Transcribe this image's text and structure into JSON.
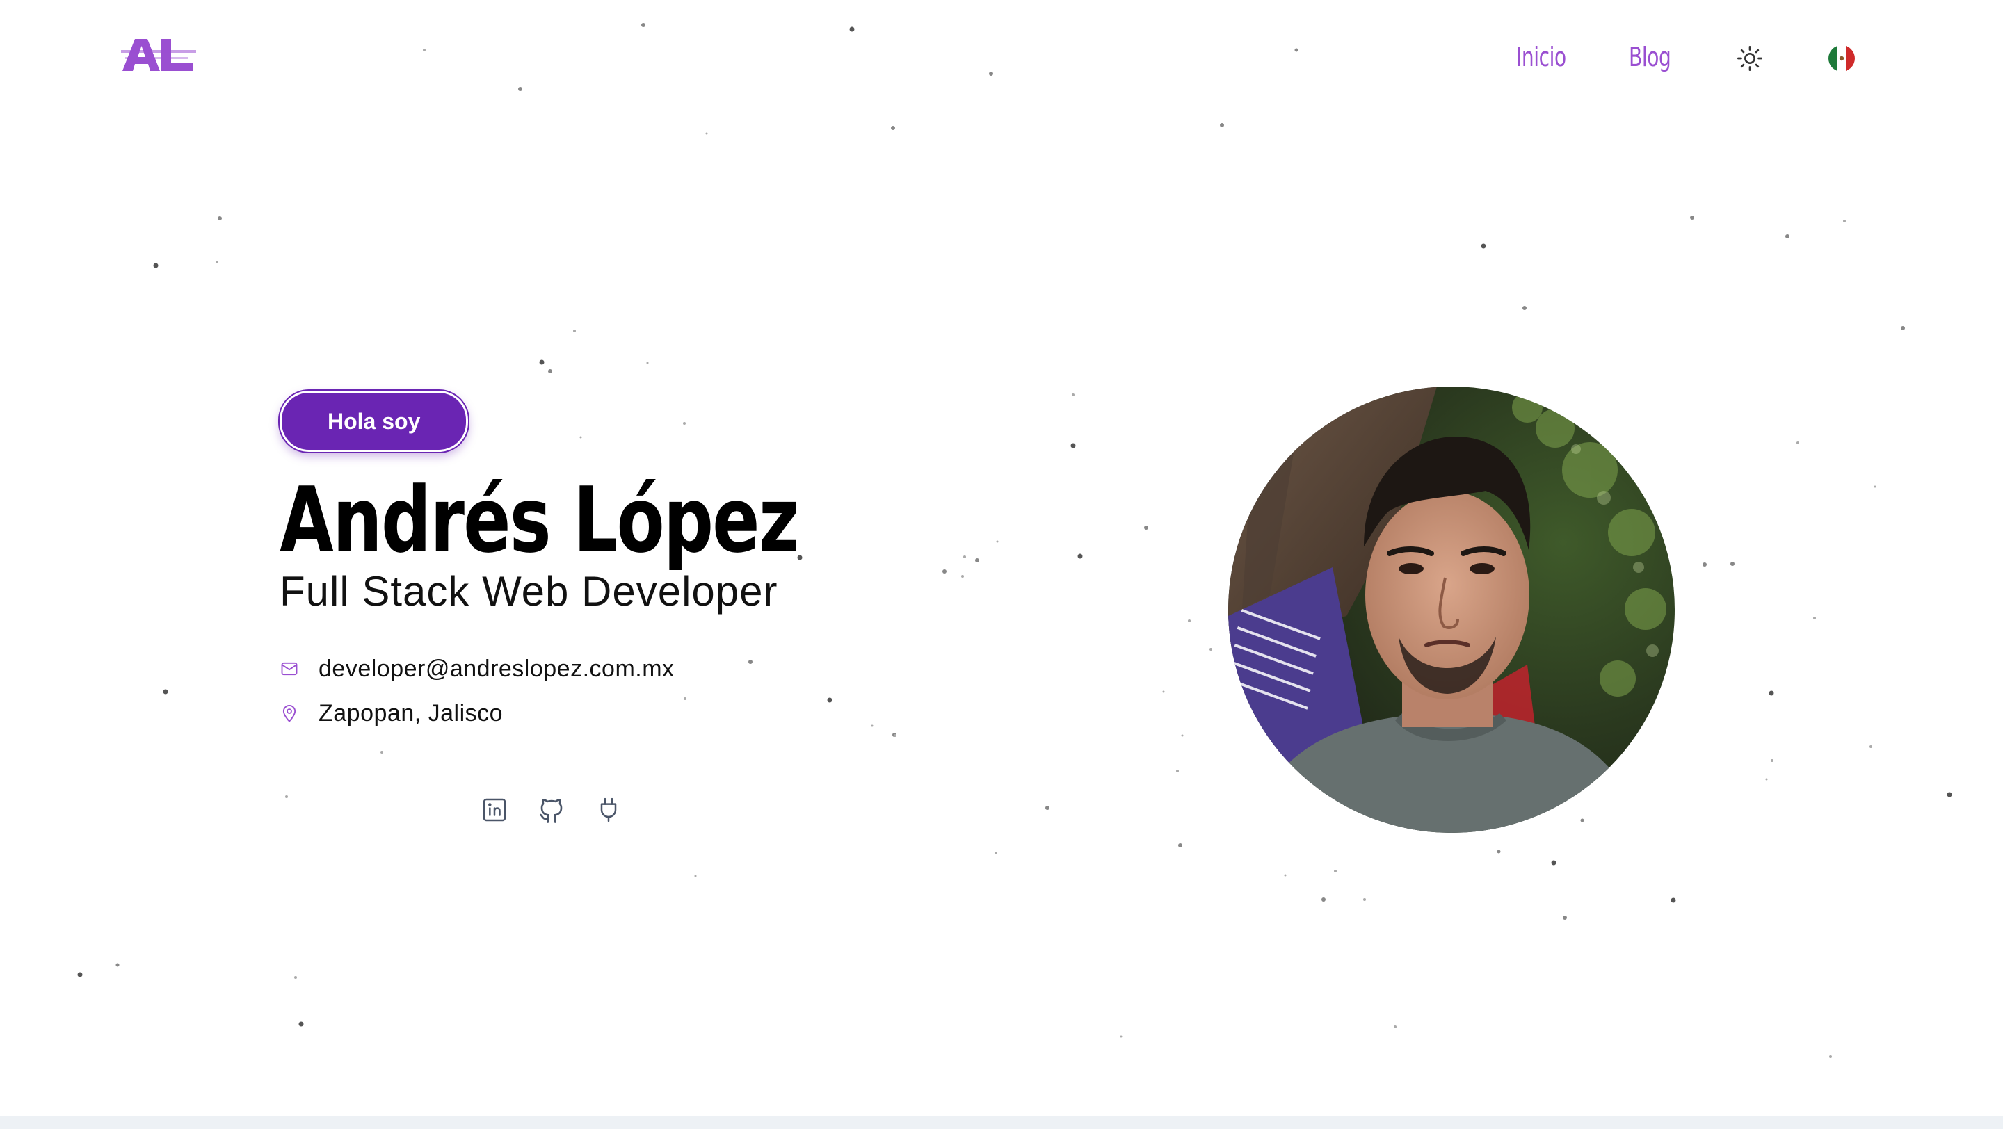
{
  "header": {
    "logo_text": "AL",
    "nav": [
      {
        "label": "Inicio"
      },
      {
        "label": "Blog"
      }
    ],
    "theme_icon": "sun-icon",
    "language_icon": "mexico-flag-icon"
  },
  "hero": {
    "greeting_badge": "Hola soy",
    "name": "Andrés López",
    "role": "Full Stack Web Developer",
    "email": "developer@andreslopez.com.mx",
    "location": "Zapopan, Jalisco",
    "email_icon": "mail-icon",
    "location_icon": "map-pin-icon",
    "socials": [
      {
        "icon": "linkedin-icon"
      },
      {
        "icon": "github-icon"
      },
      {
        "icon": "plug-icon"
      }
    ],
    "avatar_icon": "profile-photo"
  },
  "colors": {
    "accent": "#9a4fd1",
    "badge": "#6a25b3",
    "text": "#000000",
    "icon": "#4a5568"
  }
}
